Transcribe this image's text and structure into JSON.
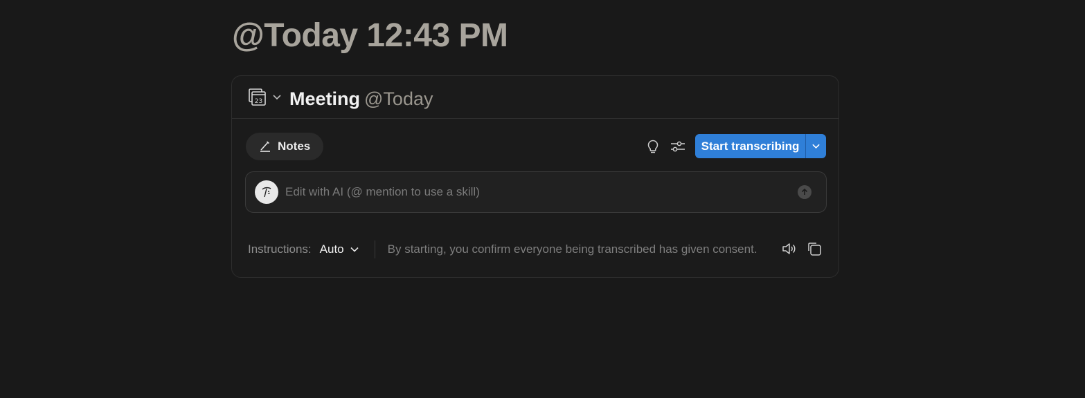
{
  "page": {
    "title": "@Today 12:43 PM"
  },
  "header": {
    "calendar_day": "23",
    "title": "Meeting",
    "date_mention": "@Today"
  },
  "toolbar": {
    "notes_label": "Notes",
    "start_label": "Start transcribing"
  },
  "ai_edit": {
    "placeholder": "Edit with AI (@ mention to use a skill)",
    "value": ""
  },
  "footer": {
    "instructions_label": "Instructions:",
    "instructions_value": "Auto",
    "consent_text": "By starting, you confirm everyone being transcribed has given consent."
  },
  "colors": {
    "background": "#191919",
    "accent": "#2f7fd8",
    "title_muted": "#a8a49c"
  },
  "icons": [
    "calendar-icon",
    "chevron-down-icon",
    "pen-icon",
    "lightbulb-icon",
    "sliders-icon",
    "ai-avatar-icon",
    "arrow-up-icon",
    "speaker-icon",
    "copy-icon"
  ]
}
